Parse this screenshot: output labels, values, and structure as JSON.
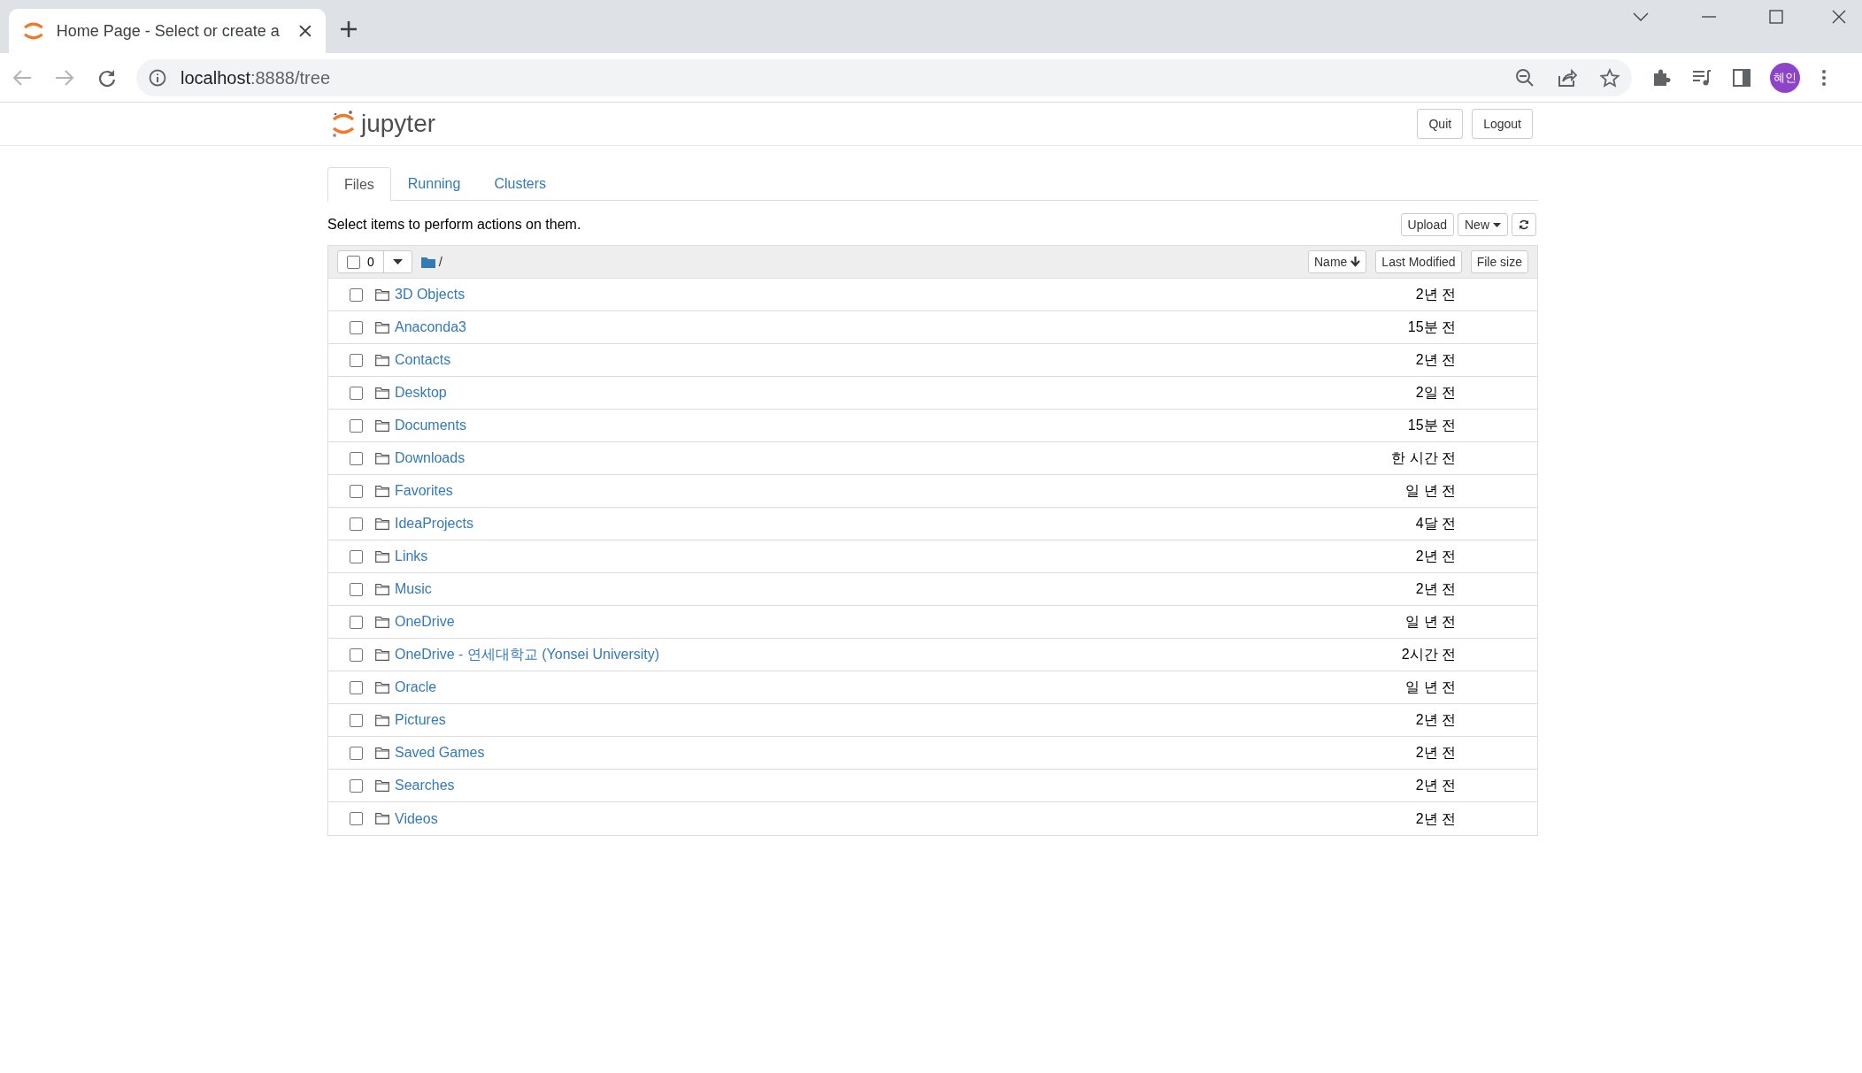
{
  "browser": {
    "tab_title": "Home Page - Select or create a",
    "url_host": "localhost",
    "url_path": ":8888/tree",
    "profile": "혜인"
  },
  "header": {
    "logo": "jupyter",
    "buttons": [
      "Quit",
      "Logout"
    ]
  },
  "tabs": [
    {
      "label": "Files",
      "selected": true
    },
    {
      "label": "Running",
      "selected": false
    },
    {
      "label": "Clusters",
      "selected": false
    }
  ],
  "toolbar": {
    "hint": "Select items to perform actions on them.",
    "buttons": [
      {
        "label": "Upload",
        "kind": "text"
      },
      {
        "label": "New",
        "kind": "dropdown"
      },
      {
        "kind": "refresh"
      }
    ]
  },
  "list_header": {
    "all_checked": false,
    "selected_count": "0",
    "path": "/",
    "sort_buttons": [
      {
        "label": "Name",
        "sorted": true
      },
      {
        "label": "Last Modified",
        "sorted": false
      },
      {
        "label": "File size",
        "sorted": false
      }
    ]
  },
  "rows": [
    {
      "name": "3D Objects",
      "modified": "2년 전",
      "checked": false
    },
    {
      "name": "Anaconda3",
      "modified": "15분 전",
      "checked": false
    },
    {
      "name": "Contacts",
      "modified": "2년 전",
      "checked": false
    },
    {
      "name": "Desktop",
      "modified": "2일 전",
      "checked": false
    },
    {
      "name": "Documents",
      "modified": "15분 전",
      "checked": false
    },
    {
      "name": "Downloads",
      "modified": "한 시간 전",
      "checked": false
    },
    {
      "name": "Favorites",
      "modified": "일 년 전",
      "checked": false
    },
    {
      "name": "IdeaProjects",
      "modified": "4달 전",
      "checked": false
    },
    {
      "name": "Links",
      "modified": "2년 전",
      "checked": false
    },
    {
      "name": "Music",
      "modified": "2년 전",
      "checked": false
    },
    {
      "name": "OneDrive",
      "modified": "일 년 전",
      "checked": false
    },
    {
      "name": "OneDrive - 연세대학교 (Yonsei University)",
      "modified": "2시간 전",
      "checked": false
    },
    {
      "name": "Oracle",
      "modified": "일 년 전",
      "checked": false
    },
    {
      "name": "Pictures",
      "modified": "2년 전",
      "checked": false
    },
    {
      "name": "Saved Games",
      "modified": "2년 전",
      "checked": false
    },
    {
      "name": "Searches",
      "modified": "2년 전",
      "checked": false
    },
    {
      "name": "Videos",
      "modified": "2년 전",
      "checked": false
    }
  ]
}
